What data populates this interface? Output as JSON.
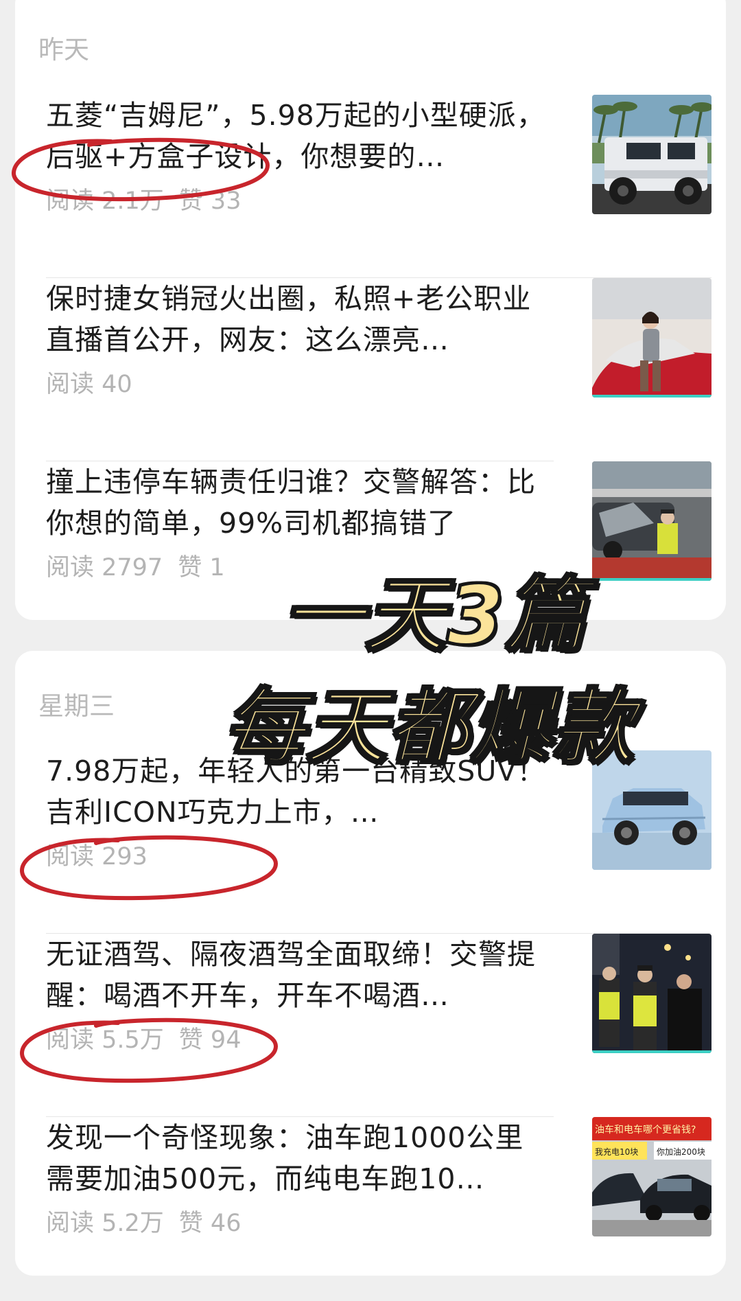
{
  "sections": [
    {
      "label": "昨天",
      "articles": [
        {
          "title": "五菱“吉姆尼”，5.98万起的小型硬派，后驱+方盒子设计，你想要的…",
          "reads": "阅读 2.1万",
          "likes": "赞 33",
          "thumb": "white-offroad-suv"
        },
        {
          "title": "保时捷女销冠火出圈，私照+老公职业直播首公开，网友：这么漂亮…",
          "reads": "阅读 40",
          "likes": "",
          "thumb": "saleswoman-in-red-car"
        },
        {
          "title": "撞上违停车辆责任归谁？交警解答：比你想的简单，99%司机都搞错了",
          "reads": "阅读 2797",
          "likes": "赞 1",
          "thumb": "car-accident-police"
        }
      ]
    },
    {
      "label": "星期三",
      "articles": [
        {
          "title": "7.98万起，年轻人的第一台精致SUV！吉利ICON巧克力上市，…",
          "reads": "阅读 293",
          "likes": "",
          "thumb": "blue-suv"
        },
        {
          "title": "无证酒驾、隔夜酒驾全面取缔！交警提醒：喝酒不开车，开车不喝酒…",
          "reads": "阅读 5.5万",
          "likes": "赞 94",
          "thumb": "police-night-checkpoint"
        },
        {
          "title": "发现一个奇怪现象：油车跑1000公里需要加油500元，而纯电车跑10…",
          "reads": "阅读 5.2万",
          "likes": "赞 46",
          "thumb": "parked-cars-banner"
        }
      ]
    }
  ],
  "overlay": {
    "line1": "一天3篇",
    "line2": "每天都爆款"
  },
  "thumb_text": {
    "banner": "油车和电车哪个更省钱?",
    "sign_left": "我充电10块",
    "sign_right": "你加油200块"
  },
  "colors": {
    "highlight_circle": "#c8252c",
    "overlay_fill": "#fbe39a"
  }
}
